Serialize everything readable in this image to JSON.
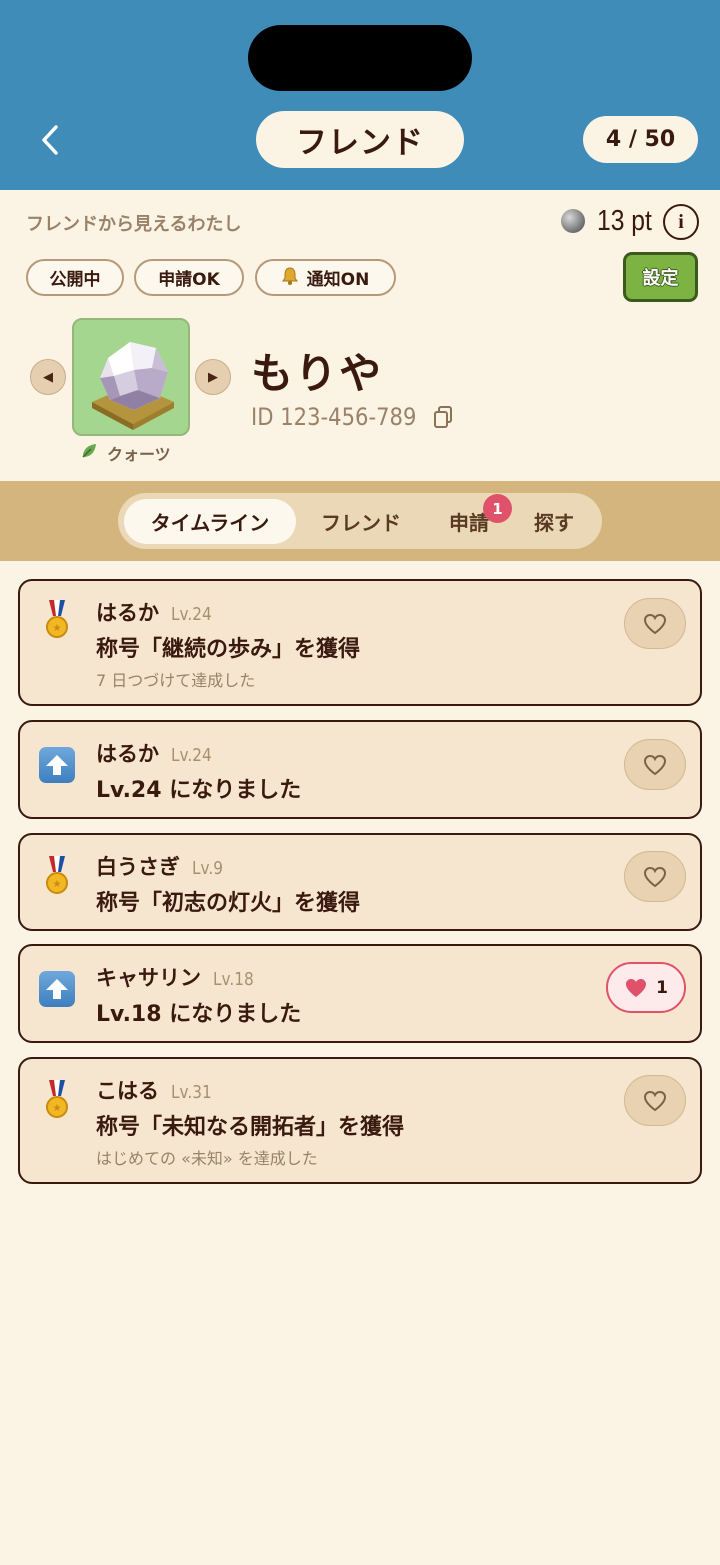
{
  "header": {
    "title": "フレンド",
    "friend_count": "4 / 50"
  },
  "profile": {
    "visible_label": "フレンドから見えるわたし",
    "points": "13 pt",
    "info_label": "i",
    "tags": {
      "public": "公開中",
      "apply": "申請OK",
      "notify": "通知ON"
    },
    "settings_label": "設定",
    "avatar_name": "クォーツ",
    "user_name": "もりや",
    "user_id": "ID 123-456-789"
  },
  "tabs": {
    "timeline": "タイムライン",
    "friends": "フレンド",
    "requests": "申請",
    "requests_badge": "1",
    "search": "探す"
  },
  "timeline": [
    {
      "icon": "medal-icon",
      "name": "はるか",
      "level": "Lv.24",
      "title": "称号「継続の歩み」を獲得",
      "sub": "7 日つづけて達成した",
      "liked": false,
      "like_count": ""
    },
    {
      "icon": "up-arrow-icon",
      "name": "はるか",
      "level": "Lv.24",
      "title": "Lv.24 になりました",
      "sub": "",
      "liked": false,
      "like_count": ""
    },
    {
      "icon": "medal-icon",
      "name": "白うさぎ",
      "level": "Lv.9",
      "title": "称号「初志の灯火」を獲得",
      "sub": "",
      "liked": false,
      "like_count": ""
    },
    {
      "icon": "up-arrow-icon",
      "name": "キャサリン",
      "level": "Lv.18",
      "title": "Lv.18 になりました",
      "sub": "",
      "liked": true,
      "like_count": "1"
    },
    {
      "icon": "medal-icon",
      "name": "こはる",
      "level": "Lv.31",
      "title": "称号「未知なる開拓者」を獲得",
      "sub": "はじめての «未知» を達成した",
      "liked": false,
      "like_count": ""
    }
  ],
  "colors": {
    "header_bg": "#3f8cb8",
    "page_bg": "#fbf3e4",
    "tab_band": "#d4b57d",
    "settings_green": "#7cb342",
    "badge_red": "#e0526a"
  }
}
